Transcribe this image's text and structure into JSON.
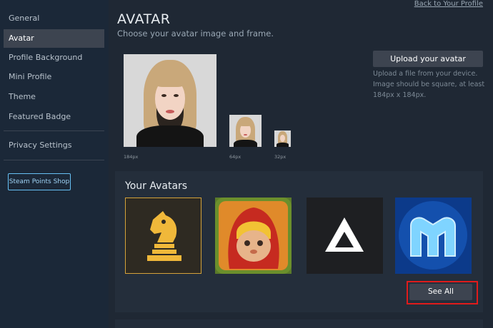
{
  "sidebar": {
    "items": [
      {
        "label": "General"
      },
      {
        "label": "Avatar"
      },
      {
        "label": "Profile Background"
      },
      {
        "label": "Mini Profile"
      },
      {
        "label": "Theme"
      },
      {
        "label": "Featured Badge"
      },
      {
        "label": "Privacy Settings"
      }
    ],
    "active": "Avatar",
    "points_shop": "Steam Points Shop"
  },
  "header": {
    "back_link": "Back to Your Profile",
    "title": "AVATAR",
    "subtitle": "Choose your avatar image and frame."
  },
  "upload": {
    "button": "Upload your avatar",
    "help": "Upload a file from your device. Image should be square, at least 184px x 184px."
  },
  "previews": [
    {
      "size_label": "184px"
    },
    {
      "size_label": "64px"
    },
    {
      "size_label": "32px"
    }
  ],
  "avatars": {
    "title": "Your Avatars",
    "items": [
      {
        "icon": "chess-knight-icon"
      },
      {
        "icon": "red-hood-character-icon"
      },
      {
        "icon": "triangle-logo-icon"
      },
      {
        "icon": "m-logo-icon"
      }
    ],
    "see_all": "See All"
  },
  "colors": {
    "background": "#1b2838",
    "accent": "#67c1f5",
    "highlight": "#e01b1b"
  }
}
